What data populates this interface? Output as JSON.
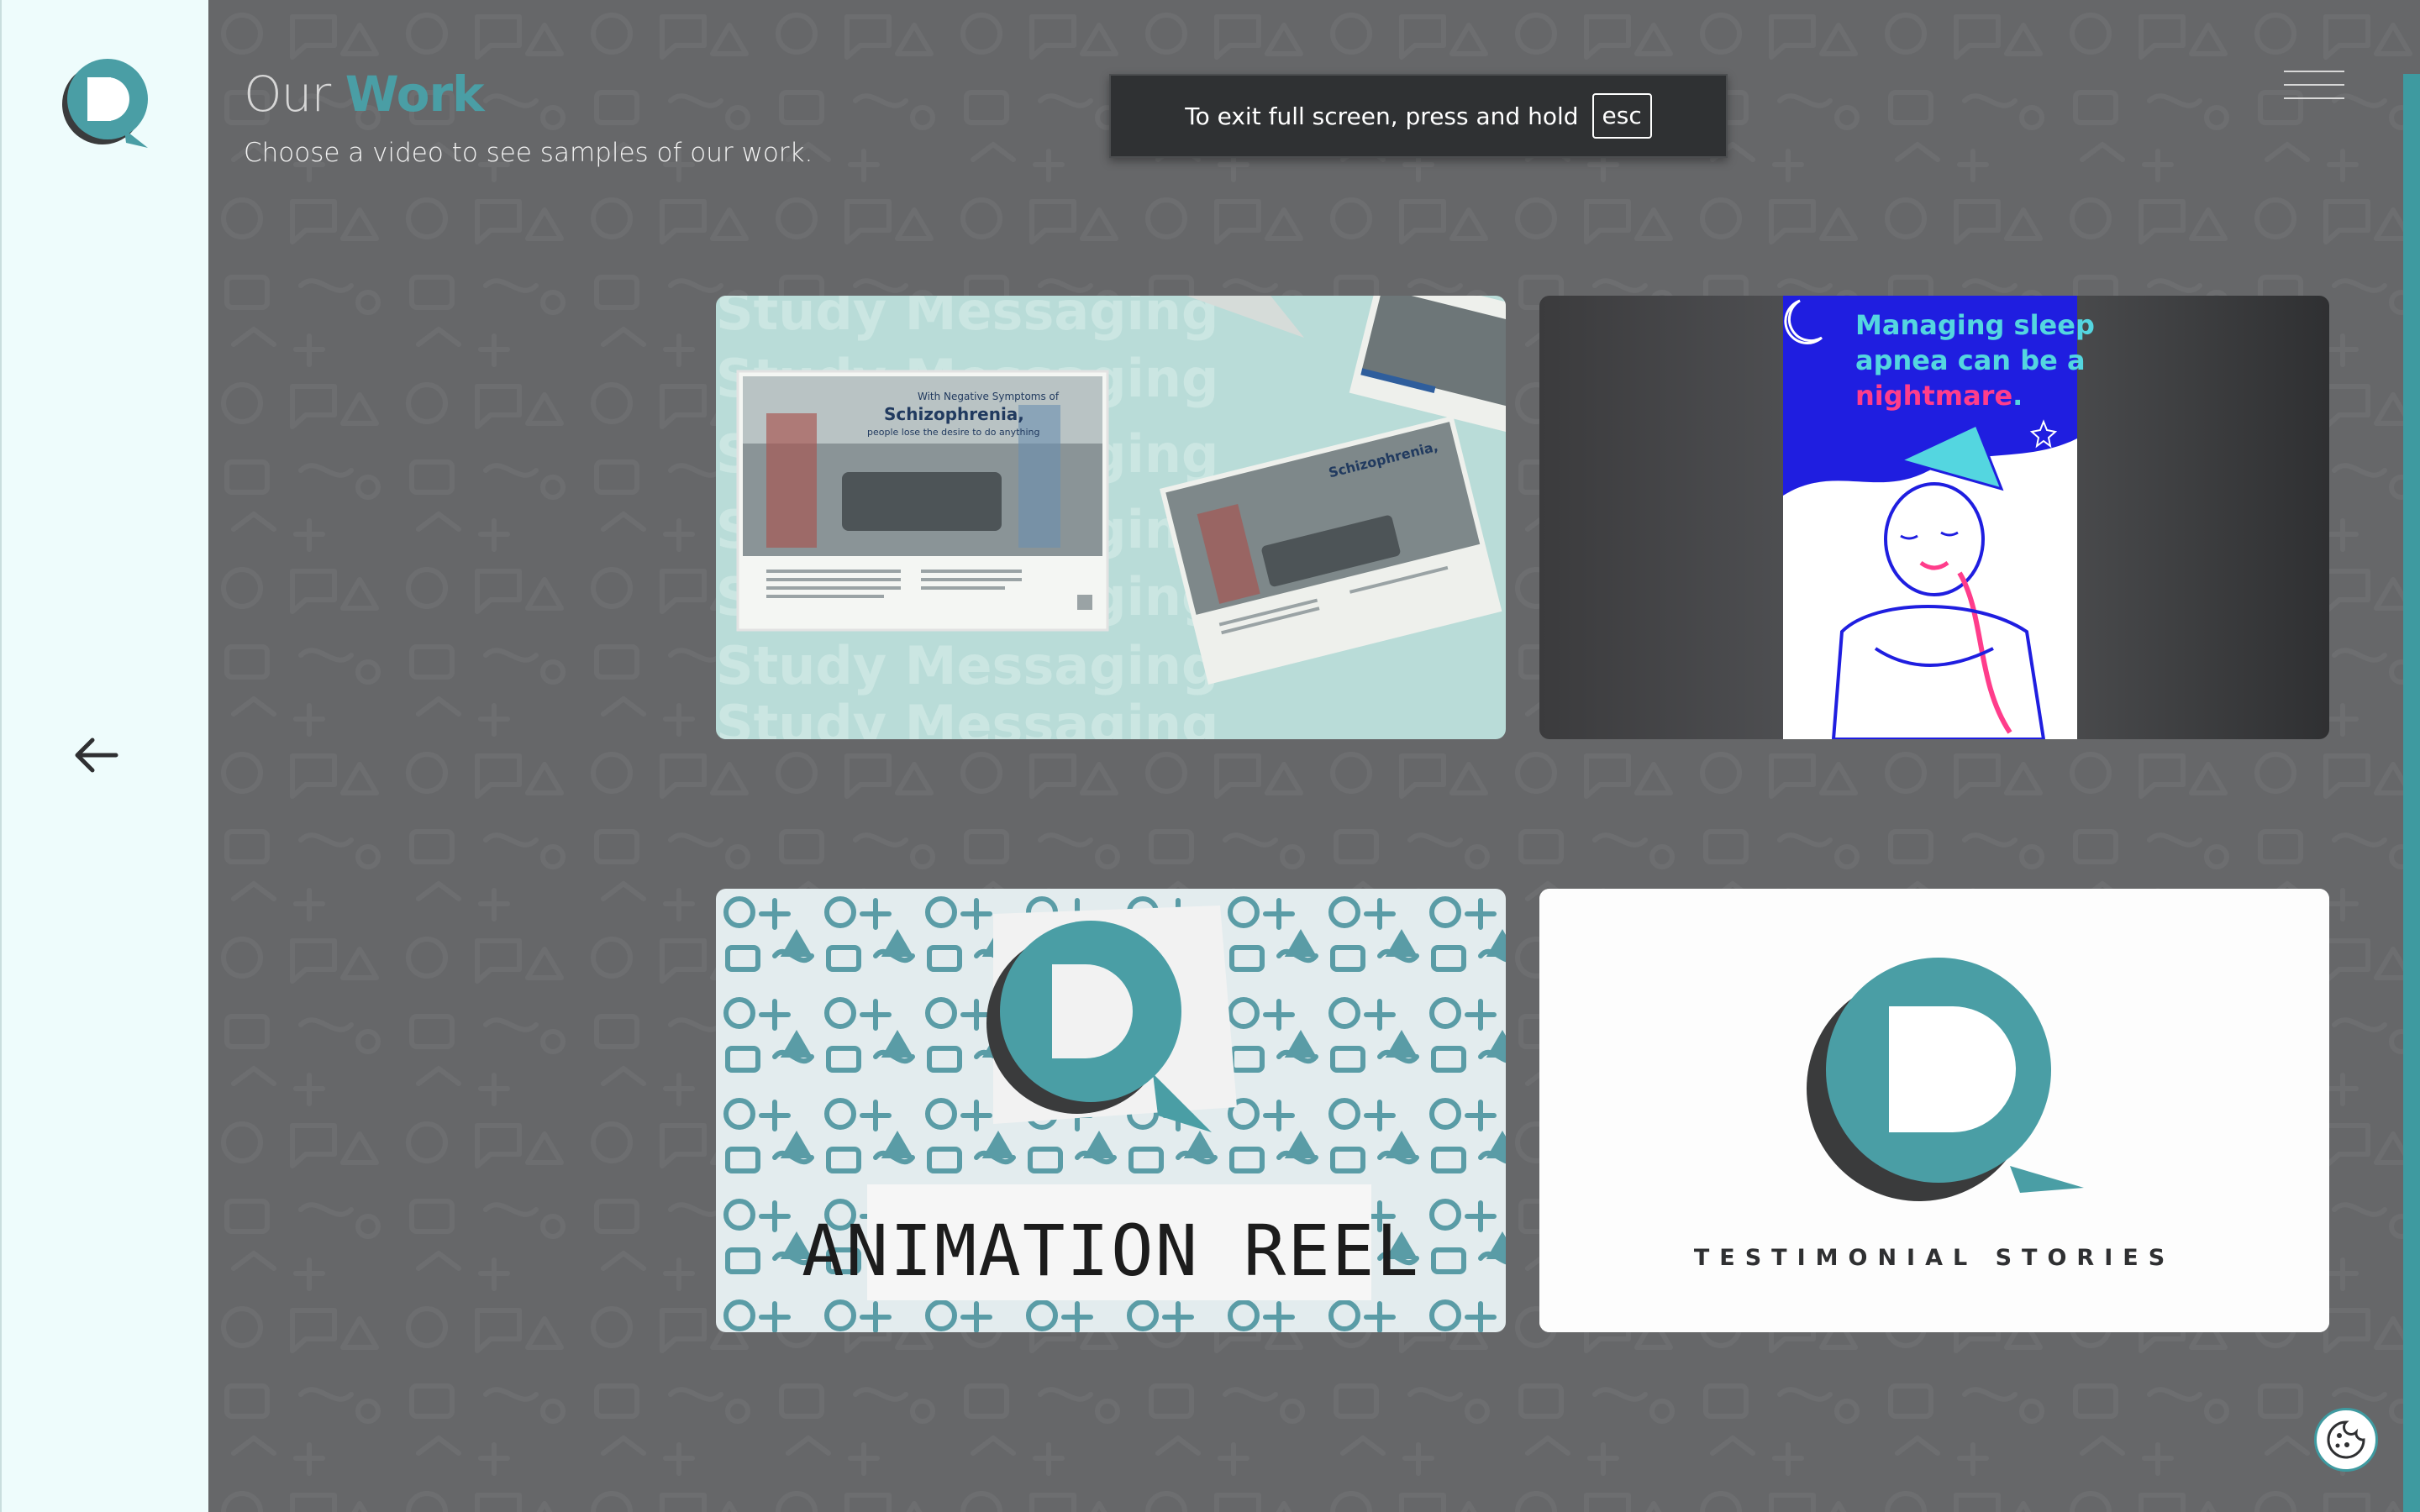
{
  "colors": {
    "brand_teal": "#4a9ea5",
    "sidebar_bg": "#eefcfc",
    "overlay_gray": "#666769",
    "toast_bg": "#2f3133",
    "apnea_blue": "#1f1ee0",
    "apnea_pink": "#ff3d8b"
  },
  "sidebar": {
    "logo_icon": "q-logo-icon",
    "back_icon": "arrow-left-icon"
  },
  "header": {
    "title_light": "Our",
    "title_bold": "Work",
    "subtitle": "Choose a video to see samples of our work.",
    "menu_icon": "hamburger-menu-icon"
  },
  "fullscreen_toast": {
    "message": "To exit full screen, press and hold",
    "key": "esc"
  },
  "videos": [
    {
      "bg_text": "Study Messaging",
      "flyer_heading": "With Negative Symptoms of",
      "flyer_title": "Schizophrenia,",
      "flyer_subtitle": "people lose the desire to do anything"
    },
    {
      "line1": "Managing sleep",
      "line2": "apnea can be a",
      "line3": "nightmare",
      "line3_suffix": "."
    },
    {
      "title": "ANIMATION REEL"
    },
    {
      "title": "TESTIMONIAL STORIES"
    }
  ],
  "cookie_icon": "cookie-icon"
}
